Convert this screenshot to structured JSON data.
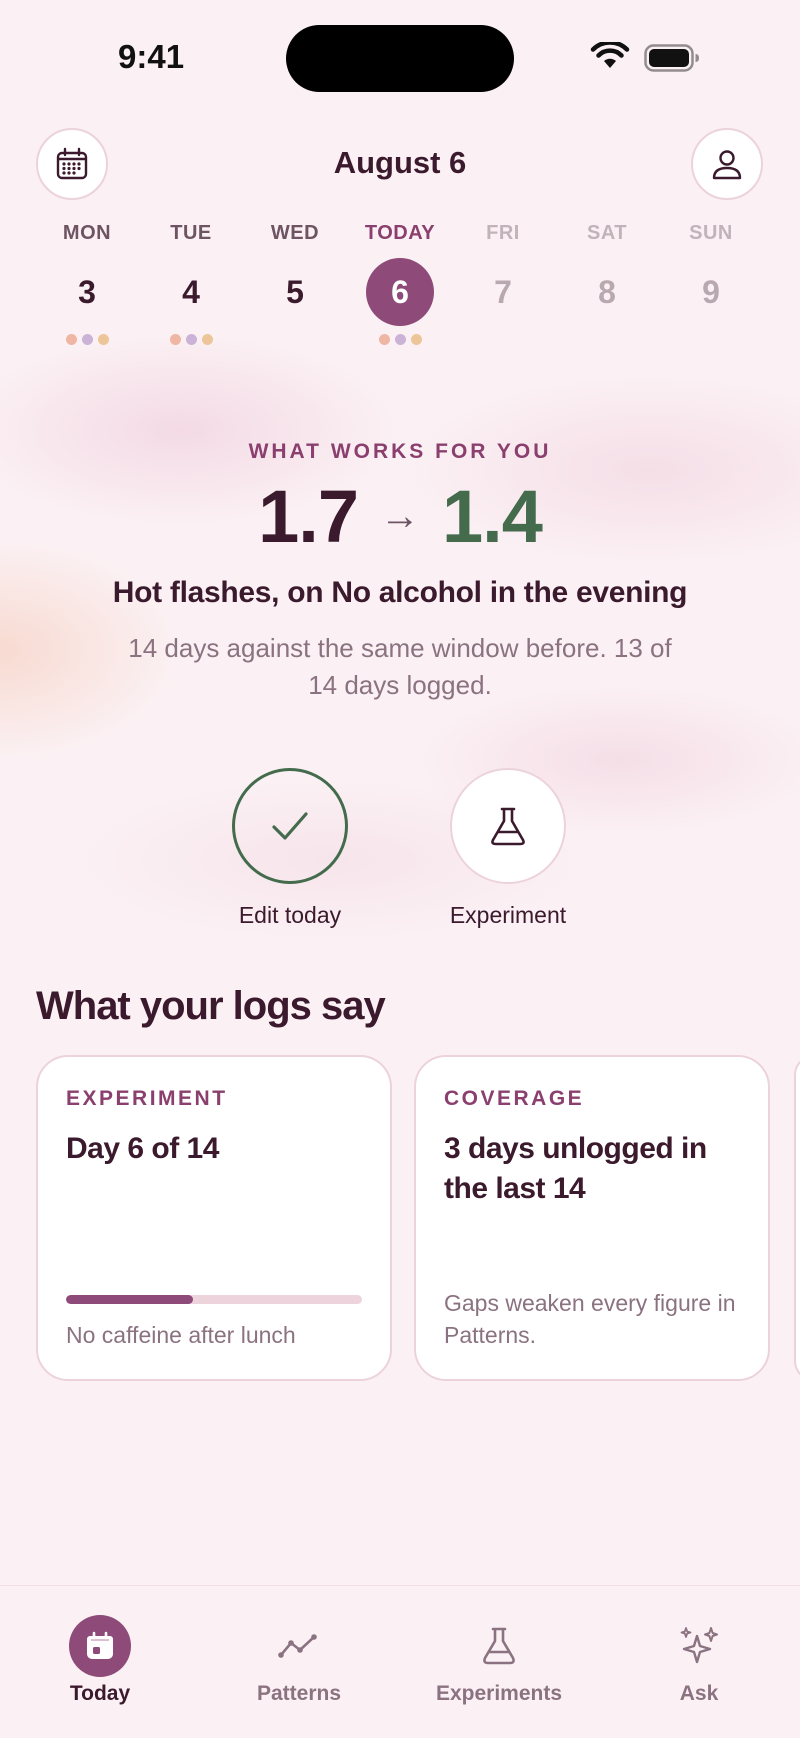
{
  "status_bar": {
    "time": "9:41"
  },
  "header": {
    "title": "August 6",
    "calendar_icon": "calendar-icon",
    "profile_icon": "person-icon"
  },
  "week": [
    {
      "name": "MON",
      "num": "3",
      "state": "past",
      "dots": [
        "#efb6a3",
        "#cbb3d8",
        "#ecc699"
      ]
    },
    {
      "name": "TUE",
      "num": "4",
      "state": "past",
      "dots": [
        "#efb6a3",
        "#cbb3d8",
        "#ecc699"
      ]
    },
    {
      "name": "WED",
      "num": "5",
      "state": "past",
      "dots": []
    },
    {
      "name": "TODAY",
      "num": "6",
      "state": "today",
      "dots": [
        "#efb6a3",
        "#cbb3d8",
        "#ecc699"
      ]
    },
    {
      "name": "FRI",
      "num": "7",
      "state": "future",
      "dots": []
    },
    {
      "name": "SAT",
      "num": "8",
      "state": "future",
      "dots": []
    },
    {
      "name": "SUN",
      "num": "9",
      "state": "future",
      "dots": []
    }
  ],
  "hero": {
    "eyebrow": "WHAT WORKS FOR YOU",
    "before": "1.7",
    "arrow": "→",
    "after": "1.4",
    "title": "Hot flashes, on No alcohol in the evening",
    "subtitle": "14 days against the same window before. 13 of 14 days logged."
  },
  "actions": {
    "edit": {
      "label": "Edit today",
      "icon": "checkmark-icon"
    },
    "experiment": {
      "label": "Experiment",
      "icon": "flask-icon"
    }
  },
  "section": {
    "title": "What your logs say"
  },
  "cards": {
    "experiment": {
      "kicker": "EXPERIMENT",
      "title": "Day 6 of 14",
      "progress": 0.43,
      "footer": "No caffeine after lunch"
    },
    "coverage": {
      "kicker": "COVERAGE",
      "title": "3 days unlogged in the last 14",
      "footer": "Gaps weaken every figure in Patterns."
    }
  },
  "tabs": [
    {
      "label": "Today",
      "icon": "calendar-icon",
      "active": true
    },
    {
      "label": "Patterns",
      "icon": "trend-line-icon",
      "active": false
    },
    {
      "label": "Experiments",
      "icon": "flask-icon",
      "active": false
    },
    {
      "label": "Ask",
      "icon": "sparkles-icon",
      "active": false
    }
  ],
  "colors": {
    "accent": "#8e4a78",
    "positive": "#436b4c",
    "text": "#3a1a2c",
    "muted": "#8b7280",
    "background": "#fbf1f4"
  }
}
